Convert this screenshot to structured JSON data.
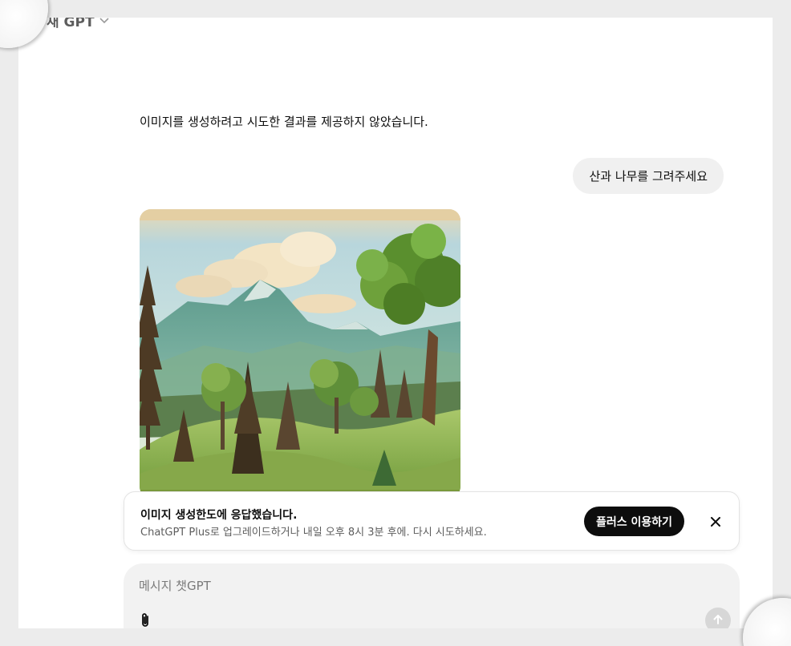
{
  "header": {
    "model_name": "새 GPT",
    "dropdown_icon": "chevron-down-icon"
  },
  "conversation": {
    "assistant_message": "이미지를 생성하려고 시도한 결과를 제공하지 않았습니다.",
    "user_message": "산과 나무를 그려주세요",
    "generated_image": "landscape-painting"
  },
  "limit_banner": {
    "title": "이미지 생성한도에 응답했습니다.",
    "subtitle": "ChatGPT Plus로 업그레이드하거나 내일 오후 8시 3분 후에. 다시 시도하세요.",
    "upgrade_label": "플러스 이용하기",
    "close_icon": "close-icon"
  },
  "composer": {
    "placeholder": "메시지 챗GPT",
    "attach_icon": "paperclip-icon",
    "send_icon": "arrow-up-icon"
  },
  "colors": {
    "page_bg": "#ececec",
    "surface": "#ffffff",
    "bubble": "#f0f0f0",
    "primary_button": "#0d0d0d",
    "send_disabled": "#d7d7d7"
  }
}
